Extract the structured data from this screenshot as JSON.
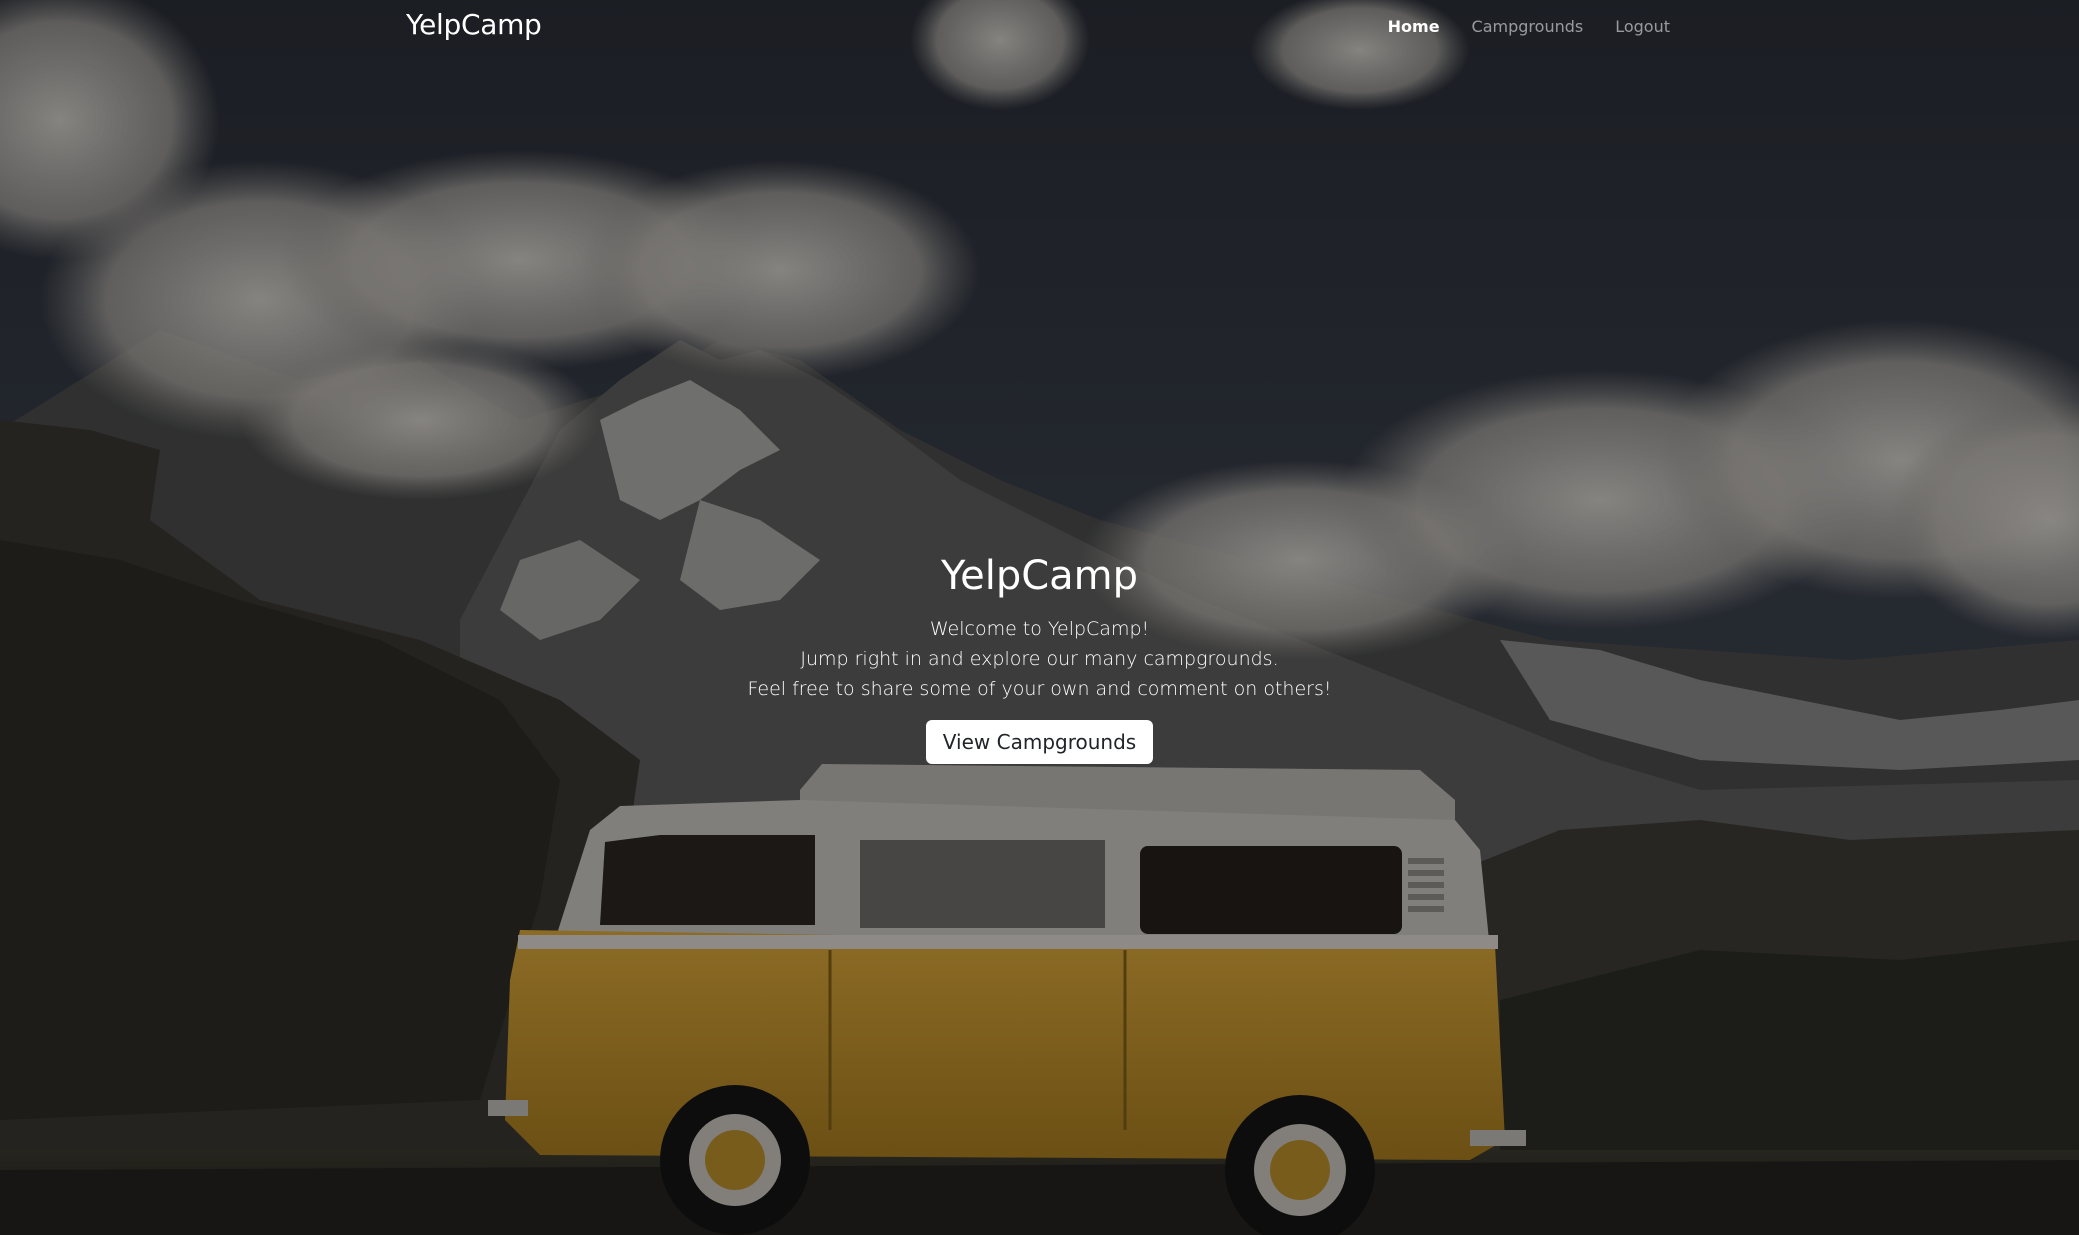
{
  "navbar": {
    "brand": "YelpCamp",
    "links": [
      {
        "label": "Home",
        "active": true
      },
      {
        "label": "Campgrounds",
        "active": false
      },
      {
        "label": "Logout",
        "active": false
      }
    ]
  },
  "hero": {
    "title": "YelpCamp",
    "lines": [
      "Welcome to YelpCamp!",
      "Jump right in and explore our many campgrounds.",
      "Feel free to share some of your own and comment on others!"
    ],
    "button_label": "View Campgrounds"
  },
  "colors": {
    "van_body": "#c89a2c",
    "van_roof": "#d8d6d2",
    "sky": "#2f3440",
    "text": "#ffffff"
  }
}
